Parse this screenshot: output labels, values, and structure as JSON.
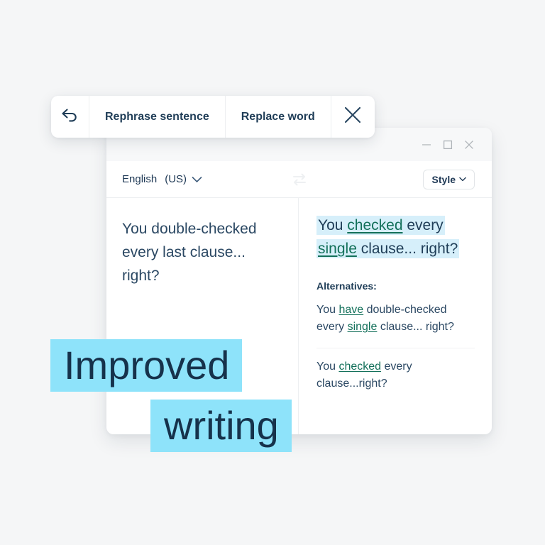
{
  "canvas": {
    "background_color": "#F5F6F7"
  },
  "action_bar": {
    "undo_icon": "undo-arrow-icon",
    "rephrase_label": "Rephrase sentence",
    "replace_label": "Replace word",
    "close_icon": "close-x-icon"
  },
  "editor_window": {
    "window_controls": {
      "minimize_icon": "minimize-icon",
      "maximize_icon": "maximize-icon",
      "close_icon": "close-icon"
    },
    "toolbar": {
      "language_name": "English",
      "language_region": "(US)",
      "language_chevron_icon": "chevron-down-icon",
      "swap_icon": "swap-arrows-icon",
      "style_label": "Style",
      "style_chevron_icon": "chevron-down-icon"
    },
    "source_panel": {
      "text": "You double-checked every last clause... right?"
    },
    "result_panel": {
      "result": {
        "part_1": "You ",
        "suggestion_1": "checked",
        "part_2": " every ",
        "suggestion_2": "single",
        "part_3": " clause... right?",
        "highlight_color": "#D6EFFA",
        "suggestion_color": "#13705A"
      },
      "alternatives_heading": "Alternatives:",
      "alternatives": [
        {
          "part_1": "You ",
          "suggestion_1": "have",
          "part_2": " double-checked every ",
          "suggestion_2": "single",
          "part_3": " clause... right?"
        },
        {
          "part_1": "You ",
          "suggestion_1": "checked",
          "part_2": " every clause...right?",
          "suggestion_2": "",
          "part_3": ""
        }
      ]
    }
  },
  "caption": {
    "line_1": "Improved",
    "line_2": "writing",
    "highlight_color": "#8EE3FA",
    "text_color": "#16324B"
  }
}
